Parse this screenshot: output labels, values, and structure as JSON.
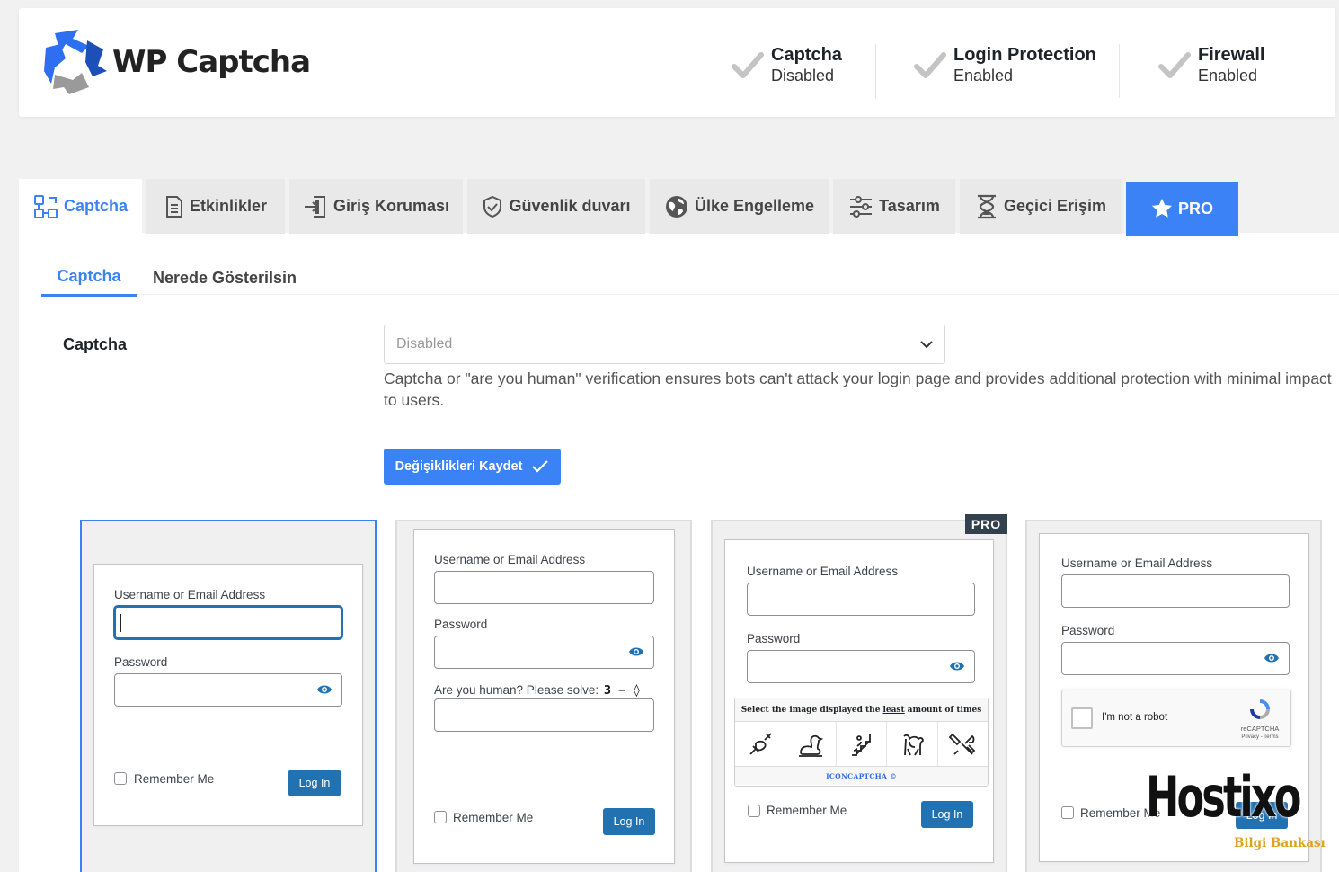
{
  "brand": {
    "name": "WP Captcha"
  },
  "status": [
    {
      "title": "Captcha",
      "value": "Disabled"
    },
    {
      "title": "Login Protection",
      "value": "Enabled"
    },
    {
      "title": "Firewall",
      "value": "Enabled"
    }
  ],
  "tabs": [
    {
      "label": "Captcha",
      "icon": "captcha-icon"
    },
    {
      "label": "Etkinlikler",
      "icon": "document-icon"
    },
    {
      "label": "Giriş Koruması",
      "icon": "login-icon"
    },
    {
      "label": "Güvenlik duvarı",
      "icon": "shield-icon"
    },
    {
      "label": "Ülke Engelleme",
      "icon": "globe-icon"
    },
    {
      "label": "Tasarım",
      "icon": "sliders-icon"
    },
    {
      "label": "Geçici Erişim",
      "icon": "hourglass-icon"
    },
    {
      "label": "PRO",
      "icon": "star-icon"
    }
  ],
  "subtabs": [
    "Captcha",
    "Nerede Gösterilsin"
  ],
  "form": {
    "label": "Captcha",
    "select_value": "Disabled",
    "help": "Captcha or \"are you human\" verification ensures bots can't attack your login page and provides additional protection with minimal impact to users.",
    "save_label": "Değişiklikleri Kaydet"
  },
  "preview": {
    "username_label": "Username or Email Address",
    "password_label": "Password",
    "remember_label": "Remember Me",
    "login_label": "Log In",
    "math_label": "Are you human? Please solve:",
    "math_expr": "3 − ◊",
    "pro_badge": "PRO",
    "iconcaptcha_prompt_pre": "Select the image displayed the ",
    "iconcaptcha_prompt_em": "least",
    "iconcaptcha_prompt_post": " amount of times",
    "iconcaptcha_footer": "ICONCAPTCHA ©",
    "recaptcha_label": "I'm not a robot",
    "recaptcha_brand": "reCAPTCHA",
    "recaptcha_links": "Privacy - Terms"
  },
  "watermark": {
    "brand": "Hostixo",
    "sub": "Bilgi Bankası"
  },
  "colors": {
    "accent": "#3b82f6",
    "wp_button": "#2271b1",
    "badge": "#33414f"
  }
}
